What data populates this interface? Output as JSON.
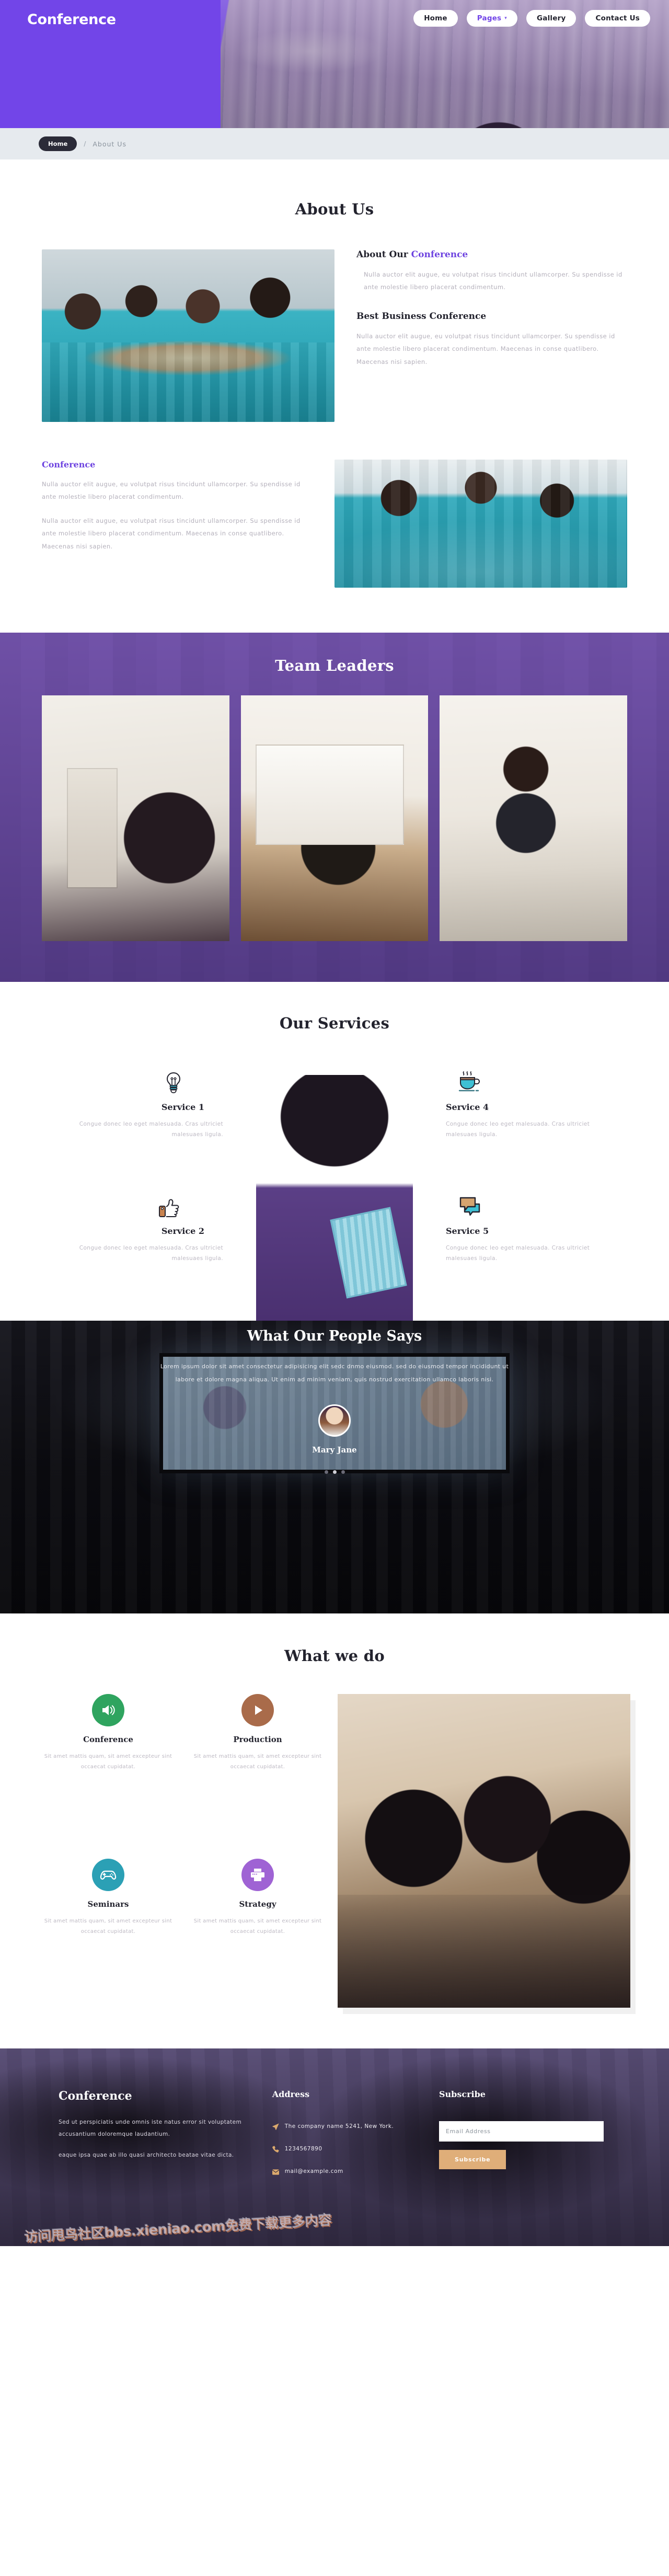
{
  "header": {
    "brand": "Conference",
    "nav": [
      {
        "label": "Home",
        "active": false,
        "caret": false
      },
      {
        "label": "Pages",
        "active": true,
        "caret": true
      },
      {
        "label": "Gallery",
        "active": false,
        "caret": false
      },
      {
        "label": "Contact Us",
        "active": false,
        "caret": false
      }
    ]
  },
  "breadcrumb": {
    "home": "Home",
    "separator": "/",
    "current": "About Us"
  },
  "about": {
    "title": "About Us",
    "heading1_prefix": "About Our ",
    "heading1_accent": "Conference",
    "para1": "Nulla auctor elit augue, eu volutpat risus tincidunt ullamcorper. Su spendisse id ante molestie libero placerat condimentum.",
    "heading2": "Best Business Conference",
    "para2": "Nulla auctor elit augue, eu volutpat risus tincidunt ullamcorper. Su spendisse id ante molestie libero placerat condimentum. Maecenas in conse quatlibero. Maecenas nisi sapien.",
    "heading3": "Conference",
    "para3": "Nulla auctor elit augue, eu volutpat risus tincidunt ullamcorper. Su spendisse id ante molestie libero placerat condimentum.",
    "para4": "Nulla auctor elit augue, eu volutpat risus tincidunt ullamcorper. Su spendisse id ante molestie libero placerat condimentum. Maecenas in conse quatlibero. Maecenas nisi sapien."
  },
  "team": {
    "title": "Team Leaders",
    "cards": [
      "team-photo-1",
      "team-photo-2",
      "team-photo-3"
    ]
  },
  "services": {
    "title": "Our Services",
    "items": [
      {
        "icon": "lightbulb-icon",
        "title": "Service 1",
        "desc": "Congue donec leo eget malesuada. Cras ultriciet malesuaes ligula.",
        "side": "left"
      },
      {
        "icon": "thumbs-up-icon",
        "title": "Service 2",
        "desc": "Congue donec leo eget malesuada. Cras ultriciet malesuaes ligula.",
        "side": "left"
      },
      {
        "icon": "coffee-cup-icon",
        "title": "Service 4",
        "desc": "Congue donec leo eget malesuada. Cras ultriciet malesuaes ligula.",
        "side": "right"
      },
      {
        "icon": "chat-bubbles-icon",
        "title": "Service 5",
        "desc": "Congue donec leo eget malesuada. Cras ultriciet malesuaes ligula.",
        "side": "right"
      }
    ]
  },
  "testimonial": {
    "title": "What Our People Says",
    "quote": "Lorem ipsum dolor sit amet consectetur adipisicing elit sedc dnmo eiusmod. sed do eiusmod tempor incididunt ut labore et dolore magna aliqua. Ut enim ad minim veniam, quis nostrud exercitation ullamco laboris nisi.",
    "name": "Mary Jane",
    "dots": 3,
    "active_dot": 1
  },
  "what_we_do": {
    "title": "What we do",
    "items": [
      {
        "icon": "speaker-icon",
        "title": "Conference",
        "color": "#2fa45f",
        "desc": "Sit amet mattis quam, sit amet excepteur sint occaecat cupidatat."
      },
      {
        "icon": "play-icon",
        "title": "Production",
        "color": "#a96b4a",
        "desc": "Sit amet mattis quam, sit amet excepteur sint occaecat cupidatat."
      },
      {
        "icon": "gamepad-icon",
        "title": "Seminars",
        "color": "#2ba0b5",
        "desc": "Sit amet mattis quam, sit amet excepteur sint occaecat cupidatat."
      },
      {
        "icon": "printer-icon",
        "title": "Strategy",
        "color": "#9f63d4",
        "desc": "Sit amet mattis quam, sit amet excepteur sint occaecat cupidatat."
      }
    ]
  },
  "footer": {
    "brand": "Conference",
    "about1": "Sed ut perspiciatis unde omnis iste natus error sit voluptatem accusantium doloremque laudantium.",
    "about2": "eaque ipsa quae ab illo quasi architecto beatae vitae dicta.",
    "address_title": "Address",
    "address_lines": [
      {
        "icon": "location-arrow-icon",
        "text": "The company name 5241, New York."
      },
      {
        "icon": "phone-icon",
        "text": "1234567890"
      },
      {
        "icon": "mail-icon",
        "text": "mail@example.com"
      }
    ],
    "subscribe_title": "Subscribe",
    "email_placeholder": "Email Address",
    "email_value": "",
    "subscribe_button": "Subscribe",
    "watermark": "访问甩鸟社区bbs.xieniao.com免费下载更多内容"
  },
  "colors": {
    "brand_purple": "#7245e8",
    "accent_purple": "#6d43e0",
    "accent_tan": "#dfae79",
    "teal": "#2ba0b5"
  }
}
